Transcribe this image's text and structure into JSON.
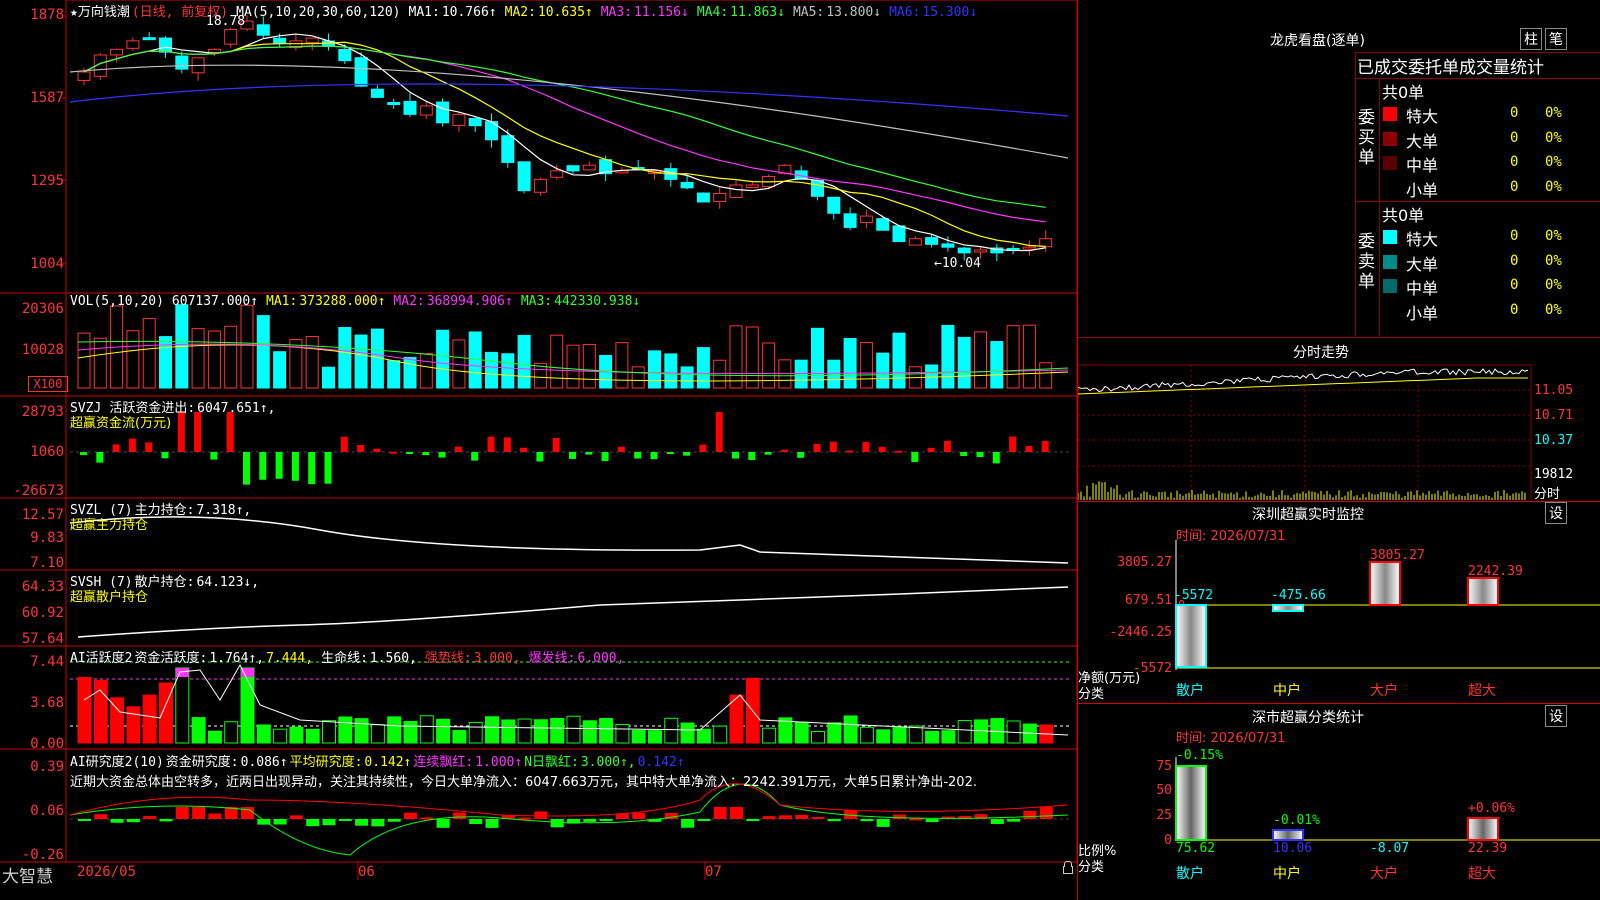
{
  "kline": {
    "title": "★万向钱潮",
    "period": "(日线, 前复权)",
    "ma_label": "MA(5,10,20,30,60,120)",
    "ma": [
      {
        "label": "MA1:",
        "value": "10.766↑",
        "color": "#ffffff"
      },
      {
        "label": "MA2:",
        "value": "10.635↑",
        "color": "#ffff00"
      },
      {
        "label": "MA3:",
        "value": "11.156↓",
        "color": "#ff33ff"
      },
      {
        "label": "MA4:",
        "value": "11.863↓",
        "color": "#33ff33"
      },
      {
        "label": "MA5:",
        "value": "13.800↓",
        "color": "#c0c0c0"
      },
      {
        "label": "MA6:",
        "value": "15.300↓",
        "color": "#3333ff"
      }
    ],
    "ticks": [
      "1878",
      "1587",
      "1295",
      "1004"
    ],
    "high_label": "18.78",
    "low_label": "←10.04"
  },
  "vol": {
    "title": "VOL(5,10,20)",
    "value": "607137.000↑",
    "mas": [
      {
        "label": "MA1:",
        "value": "373288.000↑",
        "color": "#ffff00"
      },
      {
        "label": "MA2:",
        "value": "368994.906↑",
        "color": "#ff33ff"
      },
      {
        "label": "MA3:",
        "value": "442330.938↓",
        "color": "#33ff33"
      }
    ],
    "ticks": [
      "20306",
      "10028"
    ],
    "unit": "X100"
  },
  "svzj": {
    "title": "SVZJ",
    "label": "活跃资金进出:",
    "value": "6047.651↑,",
    "subtitle": "超赢资金流(万元)",
    "ticks": [
      "28793",
      "1060",
      "-26673"
    ]
  },
  "svzl": {
    "title": "SVZL (7)",
    "label": "主力持仓:",
    "value": "7.318↑,",
    "subtitle": "超赢主力持仓",
    "ticks": [
      "12.57",
      "9.83",
      "7.10"
    ]
  },
  "svsh": {
    "title": "SVSH (7)",
    "label": "散户持仓:",
    "value": "64.123↓,",
    "subtitle": "超赢散户持仓",
    "ticks": [
      "64.33",
      "60.92",
      "57.64"
    ]
  },
  "ai_act": {
    "title": "AI活跃度2",
    "label1": "资金活跃度:",
    "value1": "1.764↑,",
    "value2": "7.444,",
    "label3": "生命线:",
    "value3": "1.560,",
    "label4": "强势线:",
    "value4": "3.000,",
    "label5": "爆发线:",
    "value5": "6.000,",
    "ticks": [
      "7.44",
      "3.68",
      "0.00"
    ]
  },
  "ai_res": {
    "title": "AI研究度2(10)",
    "label1": "资金研究度:",
    "value1": "0.086↑",
    "label2": "平均研究度:",
    "value2": "0.142↑",
    "label3": "连续飘红:",
    "value3": "1.000↑",
    "label4": "N日飘红:",
    "value4": "3.000↑,",
    "value5": "0.142↑",
    "commentary": "近期大资金总体由空转多，近两日出现异动，关注其持续性，今日大单净流入：6047.663万元，其中特大单净流入：2242.391万元，大单5日累计净出-202.",
    "ticks": [
      "0.39",
      "0.06",
      "-0.26"
    ]
  },
  "bottom": {
    "brand": "大智慧",
    "dates": [
      "2026/05",
      "06",
      "07"
    ]
  },
  "right": {
    "lhb_title": "龙虎看盘(逐单)",
    "btn1": "柱",
    "btn2": "笔",
    "stats_title": "已成交委托单成交量统计",
    "buy_group": {
      "side_label": "委买单",
      "total": "共0单",
      "rows": [
        {
          "label": "特大",
          "value": "0",
          "pct": "0%",
          "color": "#ff0000"
        },
        {
          "label": "大单",
          "value": "0",
          "pct": "0%",
          "color": "#8b0000"
        },
        {
          "label": "中单",
          "value": "0",
          "pct": "0%",
          "color": "#5a0000"
        },
        {
          "label": "小单",
          "value": "0",
          "pct": "0%",
          "color": "#000000"
        }
      ]
    },
    "sell_group": {
      "side_label": "委卖单",
      "total": "共0单",
      "rows": [
        {
          "label": "特大",
          "value": "0",
          "pct": "0%",
          "color": "#00ffff"
        },
        {
          "label": "大单",
          "value": "0",
          "pct": "0%",
          "color": "#008b8b"
        },
        {
          "label": "中单",
          "value": "0",
          "pct": "0%",
          "color": "#006b6b"
        },
        {
          "label": "小单",
          "value": "0",
          "pct": "0%",
          "color": "#000000"
        }
      ]
    },
    "fs_title": "分时走势",
    "fs_ticks": [
      "11.05",
      "10.71",
      "10.37"
    ],
    "fs_vol": "19812",
    "fs_label": "分时",
    "sz_title": "深圳超赢实时监控",
    "sz_settings": "设",
    "sz_time": "时间: 2026/07/31",
    "sz_ticks": [
      "3805.27",
      "679.51",
      "-2446.25",
      "-5572"
    ],
    "sz_values": [
      "-5572",
      "-475.66",
      "3805.27",
      "2242.39"
    ],
    "sz_zero": "0",
    "sz_ylabel": "净额(万元)",
    "sz_xlabel": "分类",
    "cats": [
      "散户",
      "中户",
      "大户",
      "超大"
    ],
    "sm_title": "深市超赢分类统计",
    "sm_settings": "设",
    "sm_time": "时间: 2026/07/31",
    "sm_ticks": [
      "75",
      "50",
      "25",
      "0"
    ],
    "sm_pct": [
      "-0.15%",
      "-0.01%",
      "+0.06%"
    ],
    "sm_values": [
      "75.62",
      "10.06",
      "-8.07",
      "22.39"
    ],
    "sm_ylabel": "比例%",
    "sm_xlabel": "分类"
  }
}
